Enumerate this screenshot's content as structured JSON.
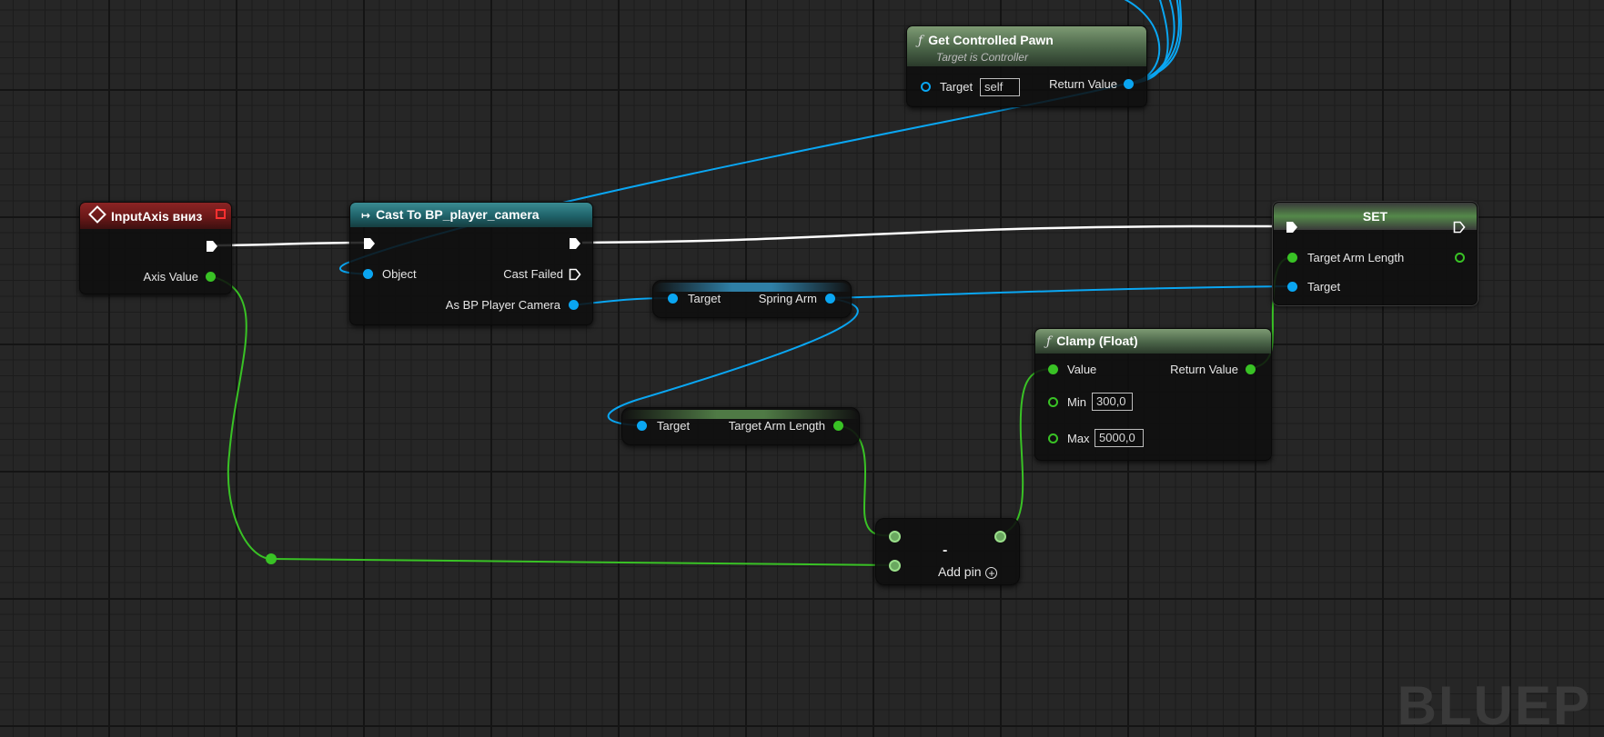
{
  "colors": {
    "float_pin": "#39c225",
    "object_pin": "#0aa6f2",
    "exec_wire": "#ffffff",
    "pure_header": "#5a7a52",
    "event_header": "#7a1e1e",
    "cast_header": "#2c7a80"
  },
  "nodes": {
    "get_controlled_pawn": {
      "title": "Get Controlled Pawn",
      "subtitle": "Target is Controller",
      "target_label": "Target",
      "target_value": "self",
      "return_label": "Return Value"
    },
    "input_axis": {
      "title": "InputAxis вниз",
      "axis_value_label": "Axis Value"
    },
    "cast": {
      "title": "Cast To BP_player_camera",
      "object_label": "Object",
      "cast_failed_label": "Cast Failed",
      "as_label": "As BP Player Camera"
    },
    "spring_arm_getter": {
      "target_label": "Target",
      "output_label": "Spring Arm"
    },
    "arm_length_getter": {
      "target_label": "Target",
      "output_label": "Target Arm Length"
    },
    "set": {
      "title": "SET",
      "arm_length_label": "Target Arm Length",
      "target_label": "Target"
    },
    "clamp": {
      "title": "Clamp (Float)",
      "value_label": "Value",
      "return_label": "Return Value",
      "min_label": "Min",
      "min_value": "300,0",
      "max_label": "Max",
      "max_value": "5000,0"
    },
    "subtract": {
      "operator": "-",
      "add_pin_label": "Add pin"
    }
  },
  "watermark": "BLUEP"
}
